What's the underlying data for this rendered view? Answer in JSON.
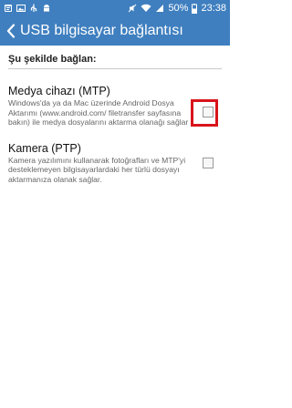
{
  "status_bar": {
    "battery": "50%",
    "time": "23:38"
  },
  "app_bar": {
    "title": "USB bilgisayar bağlantısı"
  },
  "section": {
    "header": "Şu şekilde bağlan:"
  },
  "options": [
    {
      "title": "Medya cihazı (MTP)",
      "description": "Windows'da ya da Mac üzerinde Android Dosya Aktarımı (www.android.com/ filetransfer sayfasına bakın) ile medya dosyalarını aktarma olanağı sağlar",
      "checked": false,
      "highlighted": true
    },
    {
      "title": "Kamera (PTP)",
      "description": "Kamera yazılımını kullanarak fotoğrafları ve MTP'yi desteklemeyen bilgisayarlardaki her türlü dosyayı aktarmanıza olanak sağlar.",
      "checked": false,
      "highlighted": false
    }
  ],
  "icons": {
    "back": "back-arrow-icon",
    "checkbox": "checkbox-icon"
  },
  "colors": {
    "app_bar": "#3f7fbf",
    "highlight": "#d8141c"
  }
}
